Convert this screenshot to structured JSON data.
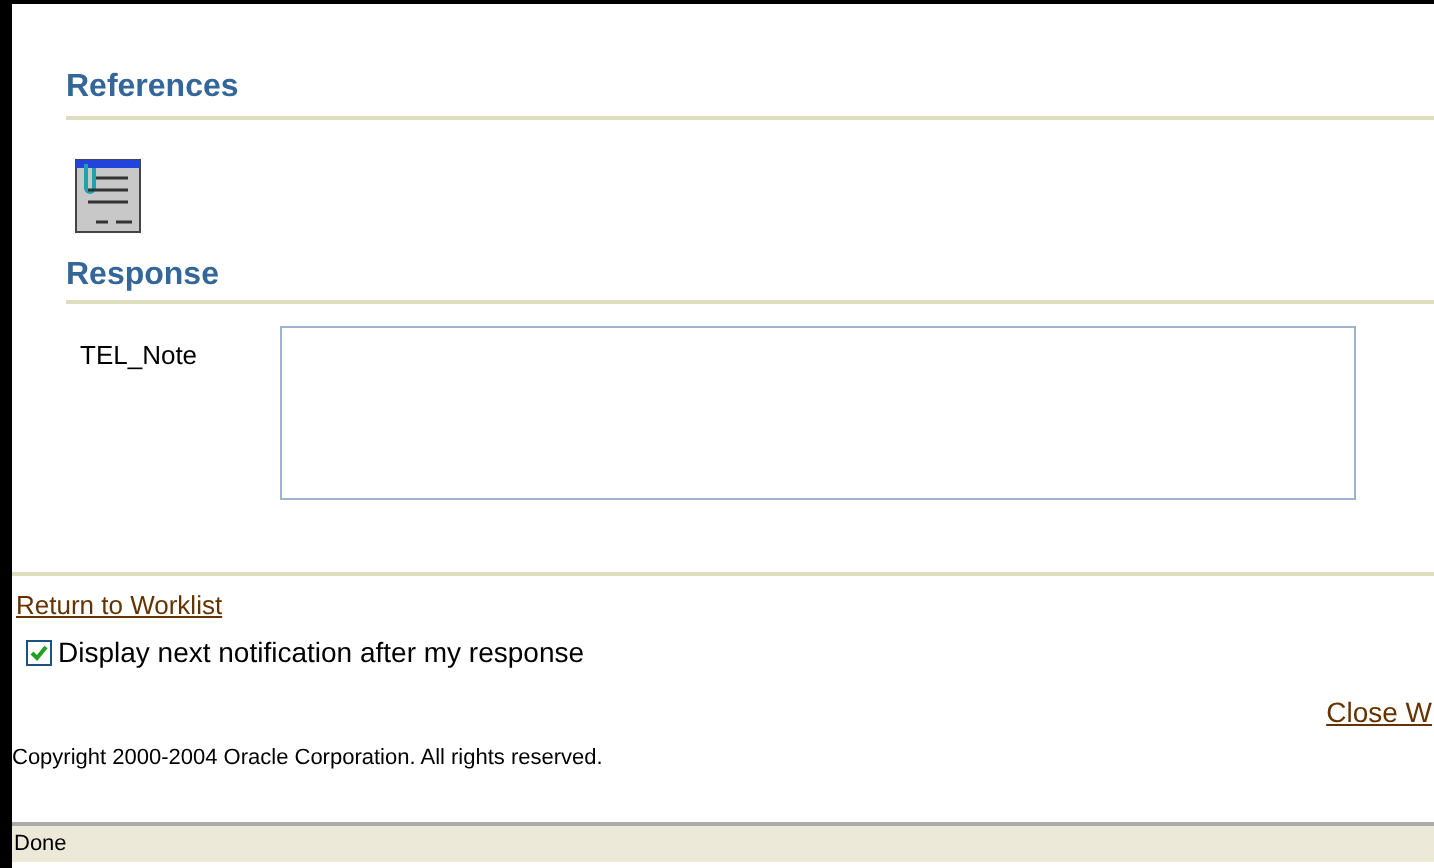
{
  "references": {
    "title": "References"
  },
  "response": {
    "title": "Response",
    "fields": [
      {
        "label": "TEL_Note"
      }
    ]
  },
  "return_link": "Return to Worklist",
  "display_next": {
    "label": "Display next notification after my response",
    "checked": true
  },
  "close_link": "Close W",
  "copyright": "Copyright 2000-2004 Oracle Corporation. All rights reserved.",
  "status_bar": "Done"
}
